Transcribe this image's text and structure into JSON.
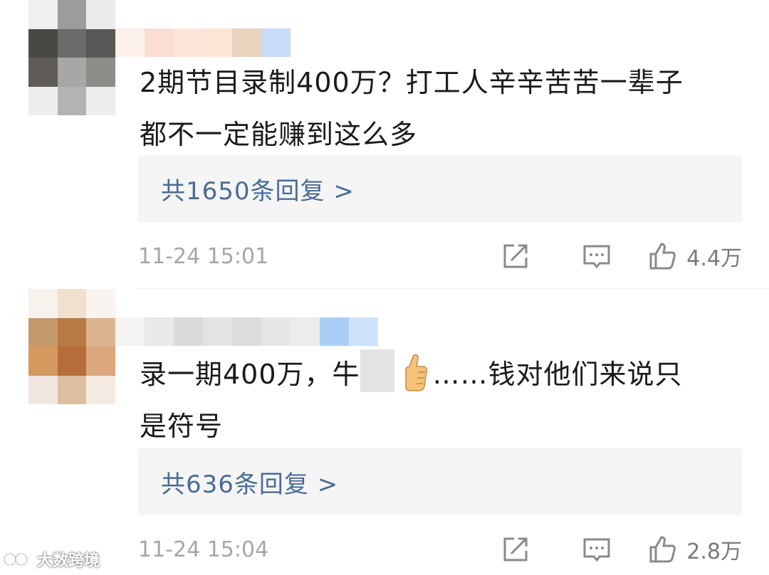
{
  "comments": [
    {
      "text_line1": "2期节目录制400万？打工人辛辛苦苦一辈子",
      "text_line2": "都不一定能赚到这么多",
      "replies_label": "共1650条回复 >",
      "time": "11-24 15:01",
      "likes": "4.4万"
    },
    {
      "text_line1_pre": "录一期400万，牛",
      "text_line1_post": "……钱对他们来说只",
      "text_line2": "是符号",
      "replies_label": "共636条回复 >",
      "time": "11-24 15:04",
      "likes": "2.8万"
    }
  ],
  "icons": {
    "share": "share-icon",
    "comment": "comment-icon",
    "like": "thumbs-up-icon"
  },
  "colors": {
    "link": "#4a6c95",
    "reply_bg": "#f5f5f5",
    "muted": "#a6a6a6"
  },
  "watermark": "大数跨境"
}
